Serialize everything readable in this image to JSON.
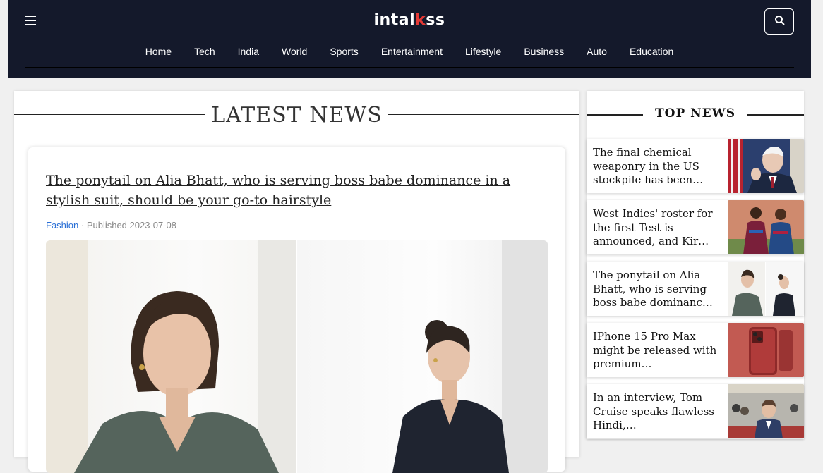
{
  "header": {
    "logo_pre": "intal",
    "logo_k": "k",
    "logo_post": "ss",
    "nav": [
      "Home",
      "Tech",
      "India",
      "World",
      "Sports",
      "Entertainment",
      "Lifestyle",
      "Business",
      "Auto",
      "Education"
    ]
  },
  "main": {
    "section_title": "LATEST NEWS",
    "article": {
      "title": "The ponytail on Alia Bhatt, who is serving boss babe dominance in a stylish suit, should be your go-to hairstyle",
      "category": "Fashion",
      "separator": " · ",
      "published": "Published 2023-07-08"
    }
  },
  "sidebar": {
    "title": "TOP NEWS",
    "items": [
      {
        "title": "The final chemical weaponry in the US stockpile has been…"
      },
      {
        "title": "West Indies' roster for the first Test is announced, and Kir…"
      },
      {
        "title": "The ponytail on Alia Bhatt, who is serving boss babe dominanc…"
      },
      {
        "title": "IPhone 15 Pro Max might be released with premium…"
      },
      {
        "title": "In an interview, Tom Cruise speaks flawless Hindi,…"
      }
    ]
  },
  "colors": {
    "header_bg": "#14192b",
    "accent_logo_k": "#e53935",
    "link_category": "#2a6fd6"
  }
}
